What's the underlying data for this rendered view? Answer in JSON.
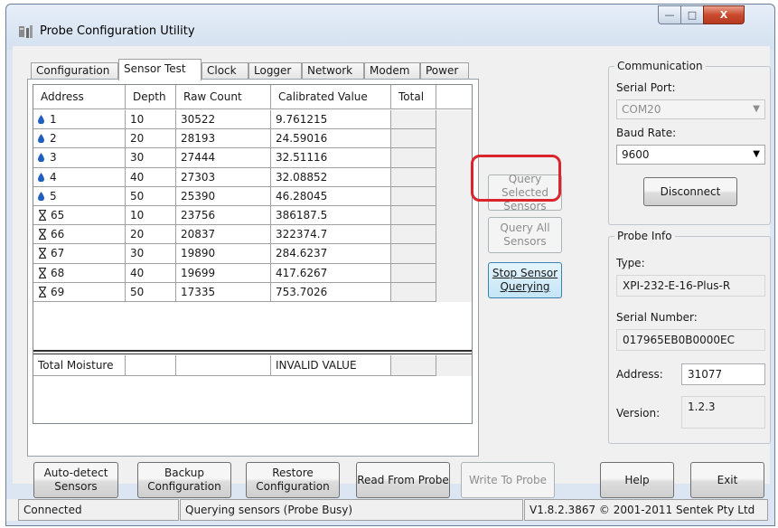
{
  "window": {
    "title": "Probe Configuration Utility",
    "minimize_label": "—",
    "maximize_label": "□",
    "close_label": "X"
  },
  "tabs": [
    "Configuration",
    "Sensor Test",
    "Clock",
    "Logger",
    "Network",
    "Modem",
    "Power"
  ],
  "active_tab": "Sensor Test",
  "sensor_table": {
    "columns": [
      "Address",
      "Depth",
      "Raw Count",
      "Calibrated Value",
      "Total"
    ],
    "rows": [
      {
        "icon": "water-drop-icon",
        "address": "1",
        "depth": "10",
        "raw": "30522",
        "calibrated": "9.761215",
        "total": ""
      },
      {
        "icon": "water-drop-icon",
        "address": "2",
        "depth": "20",
        "raw": "28193",
        "calibrated": "24.59016",
        "total": ""
      },
      {
        "icon": "water-drop-icon",
        "address": "3",
        "depth": "30",
        "raw": "27444",
        "calibrated": "32.51116",
        "total": ""
      },
      {
        "icon": "water-drop-icon",
        "address": "4",
        "depth": "40",
        "raw": "27303",
        "calibrated": "32.08852",
        "total": ""
      },
      {
        "icon": "water-drop-icon",
        "address": "5",
        "depth": "50",
        "raw": "25390",
        "calibrated": "46.28045",
        "total": ""
      },
      {
        "icon": "hourglass-icon",
        "address": "65",
        "depth": "10",
        "raw": "23756",
        "calibrated": "386187.5",
        "total": ""
      },
      {
        "icon": "hourglass-icon",
        "address": "66",
        "depth": "20",
        "raw": "20837",
        "calibrated": "322374.7",
        "total": ""
      },
      {
        "icon": "hourglass-icon",
        "address": "67",
        "depth": "30",
        "raw": "19890",
        "calibrated": "284.6237",
        "total": ""
      },
      {
        "icon": "hourglass-icon",
        "address": "68",
        "depth": "40",
        "raw": "19699",
        "calibrated": "417.6267",
        "total": ""
      },
      {
        "icon": "hourglass-icon",
        "address": "69",
        "depth": "50",
        "raw": "17335",
        "calibrated": "753.7026",
        "total": ""
      }
    ],
    "total_row": {
      "label": "Total Moisture",
      "depth": "",
      "raw": "",
      "calibrated": "INVALID VALUE",
      "total": ""
    }
  },
  "query_buttons": {
    "query_selected": "Query Selected Sensors",
    "query_all": "Query All Sensors",
    "stop": "Stop Sensor Querying"
  },
  "communication": {
    "group_label": "Communication",
    "serial_port_label": "Serial Port:",
    "serial_port_value": "COM20",
    "baud_rate_label": "Baud Rate:",
    "baud_rate_value": "9600",
    "disconnect_label": "Disconnect"
  },
  "probe_info": {
    "group_label": "Probe Info",
    "type_label": "Type:",
    "type_value": "XPI-232-E-16-Plus-R",
    "serial_label": "Serial Number:",
    "serial_value": "017965EB0B0000EC",
    "address_label": "Address:",
    "address_value": "31077",
    "version_label": "Version:",
    "version_value": "1.2.3"
  },
  "bottom_buttons": {
    "auto_detect": "Auto-detect Sensors",
    "backup": "Backup Configuration",
    "restore": "Restore Configuration",
    "read": "Read From Probe",
    "write": "Write To Probe",
    "help": "Help",
    "exit": "Exit"
  },
  "status": {
    "connection": "Connected",
    "activity": "Querying sensors (Probe Busy)",
    "version": "V1.8.2.3867 © 2001-2011 Sentek Pty Ltd"
  },
  "colors": {
    "highlight": "#d9252b",
    "water_drop": "#1f5fbf"
  }
}
